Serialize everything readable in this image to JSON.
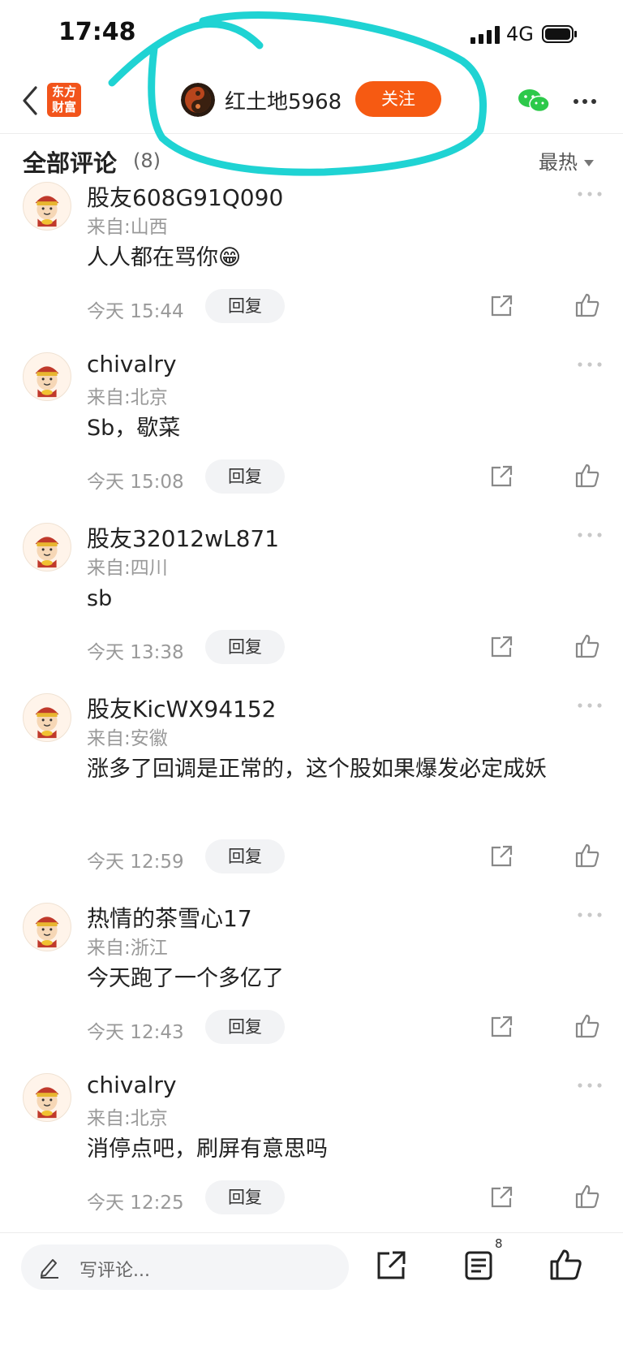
{
  "status_bar": {
    "time": "17:48",
    "network": "4G"
  },
  "nav": {
    "app_logo_line1": "东方",
    "app_logo_line2": "财富",
    "user_name": "红土地5968",
    "follow_label": "关注",
    "icons": [
      "back-arrow-icon",
      "wechat-icon",
      "more-icon"
    ]
  },
  "section": {
    "title": "全部评论",
    "count": "(8)",
    "sort_label": "最热"
  },
  "comments": [
    {
      "user": "股友608G91Q090",
      "location": "来自:山西",
      "text": "人人都在骂你😁",
      "time": "今天 15:44",
      "reply": "回复"
    },
    {
      "user": "chivalry",
      "location": "来自:北京",
      "text": "Sb，歇菜",
      "time": "今天 15:08",
      "reply": "回复"
    },
    {
      "user": "股友32012wL871",
      "location": "来自:四川",
      "text": "sb",
      "time": "今天 13:38",
      "reply": "回复"
    },
    {
      "user": "股友KicWX94152",
      "location": "来自:安徽",
      "text": "涨多了回调是正常的，这个股如果爆发必定成妖",
      "time": "今天 12:59",
      "reply": "回复"
    },
    {
      "user": "热情的茶雪心17",
      "location": "来自:浙江",
      "text": "今天跑了一个多亿了",
      "time": "今天 12:43",
      "reply": "回复"
    },
    {
      "user": "chivalry",
      "location": "来自:北京",
      "text": "消停点吧，刷屏有意思吗",
      "time": "今天 12:25",
      "reply": "回复"
    }
  ],
  "bottom_bar": {
    "placeholder": "写评论...",
    "comment_count": "8"
  },
  "colors": {
    "accent": "#f65a12",
    "annotation": "#1fd3d3"
  }
}
